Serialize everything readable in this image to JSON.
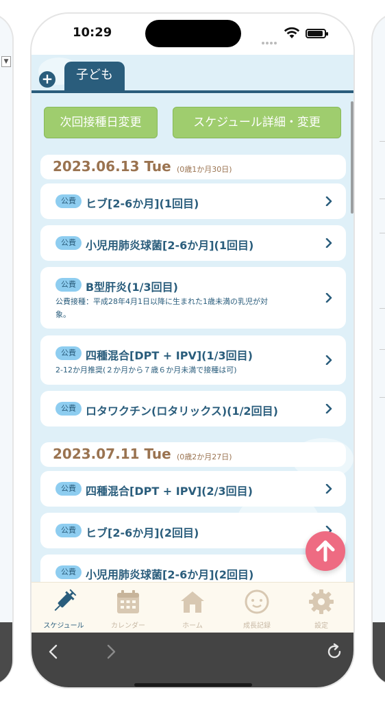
{
  "status": {
    "time": "10:29"
  },
  "tabs": {
    "child_tab_label": "子ども",
    "add_symbol": "+"
  },
  "actions": {
    "next_date_label": "次回接種日変更",
    "detail_label": "スケジュール詳細・変更"
  },
  "dates": [
    {
      "date": "2023.06.13 Tue",
      "age": "(0歳1か月30日)"
    },
    {
      "date": "2023.07.11 Tue",
      "age": "(0歳2か月27日)"
    }
  ],
  "badge_label": "公費",
  "vaccines": [
    {
      "name": "ヒブ[2-6か月](1回目)",
      "note": []
    },
    {
      "name": "小児用肺炎球菌[2-6か月](1回目)",
      "note": []
    },
    {
      "name": "B型肝炎(1/3回目)",
      "note": [
        "公費接種：平成28年4月1日以降に生まれた1歳未満の乳児が対",
        "象。"
      ]
    },
    {
      "name": "四種混合[DPT + IPV](1/3回目)",
      "note": [
        "2-12か月推奨(２か月から７歳６か月未満で接種は可)"
      ]
    },
    {
      "name": "ロタワクチン(ロタリックス)(1/2回目)",
      "note": []
    },
    {
      "name": "四種混合[DPT + IPV](2/3回目)",
      "note": []
    },
    {
      "name": "ヒブ[2-6か月](2回目)",
      "note": []
    },
    {
      "name": "小児用肺炎球菌[2-6か月](2回目)",
      "note": []
    }
  ],
  "nav": [
    {
      "label": "スケジュール",
      "icon": "syringe-icon",
      "active": true
    },
    {
      "label": "カレンダー",
      "icon": "calendar-icon",
      "active": false
    },
    {
      "label": "ホーム",
      "icon": "house-icon",
      "active": false
    },
    {
      "label": "成長記録",
      "icon": "baby-face-icon",
      "active": false
    },
    {
      "label": "設定",
      "icon": "gear-icon",
      "active": false
    }
  ],
  "colors": {
    "primary": "#2a5d7c",
    "button_green": "#9fcd6e",
    "badge_blue": "#8ecdf0",
    "date_brown": "#9a7350",
    "fab_pink": "#ee6b82",
    "background": "#dff0f8"
  },
  "browser": {
    "back": "<",
    "forward": ">"
  }
}
